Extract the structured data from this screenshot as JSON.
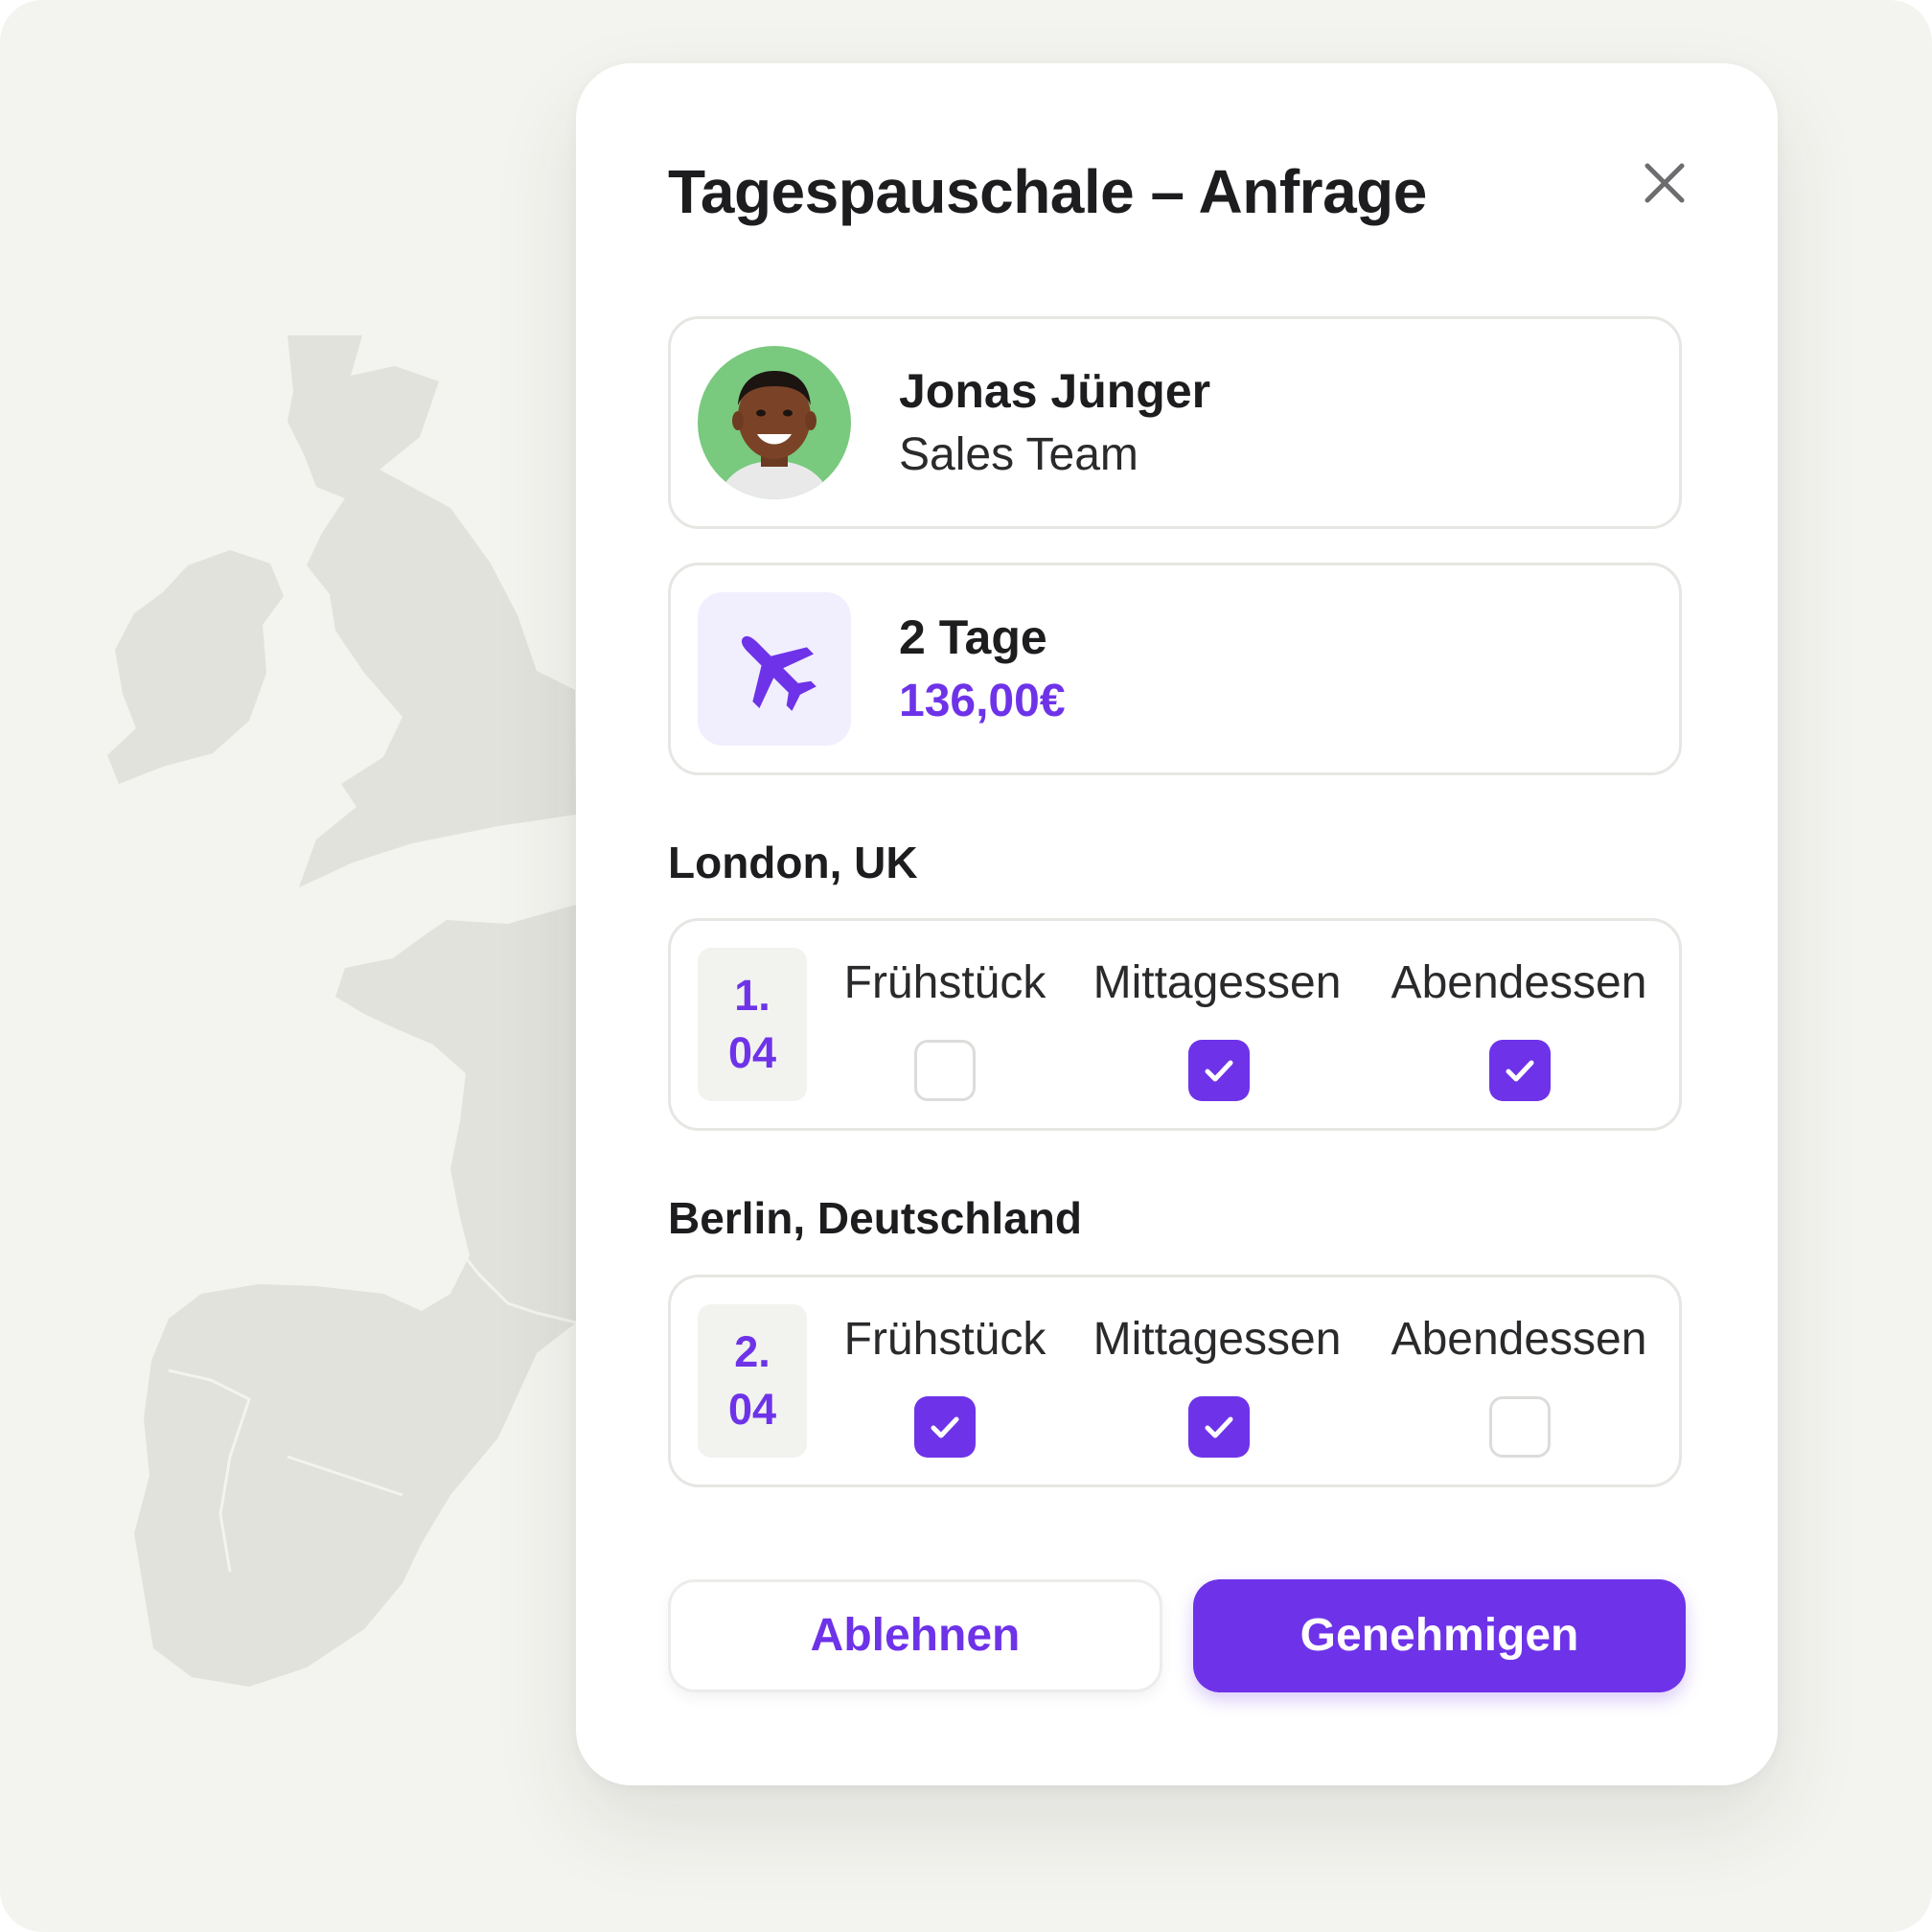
{
  "modal": {
    "title": "Tagespauschale – Anfrage",
    "close_icon": "close-icon"
  },
  "employee": {
    "name": "Jonas Jünger",
    "team": "Sales Team",
    "avatar_bg": "#79c97f"
  },
  "trip": {
    "icon": "airplane-icon",
    "duration": "2 Tage",
    "amount": "136,00€"
  },
  "days": [
    {
      "location": "London, UK",
      "date_line1": "1.",
      "date_line2": "04",
      "meals": [
        {
          "label": "Frühstück",
          "checked": false
        },
        {
          "label": "Mittagessen",
          "checked": true
        },
        {
          "label": "Abendessen",
          "checked": true
        }
      ]
    },
    {
      "location": "Berlin, Deutschland",
      "date_line1": "2.",
      "date_line2": "04",
      "meals": [
        {
          "label": "Frühstück",
          "checked": true
        },
        {
          "label": "Mittagessen",
          "checked": true
        },
        {
          "label": "Abendessen",
          "checked": false
        }
      ]
    }
  ],
  "actions": {
    "reject_label": "Ablehnen",
    "approve_label": "Genehmigen"
  },
  "colors": {
    "accent": "#6e33e8",
    "accent_light": "#f1eefe",
    "background": "#f3f3ef",
    "map_land": "#e1e2dc"
  }
}
